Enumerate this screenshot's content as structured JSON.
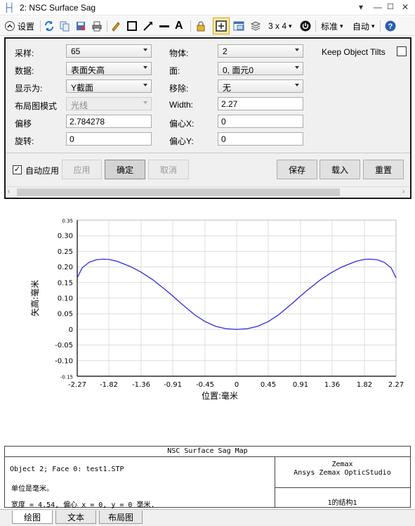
{
  "window": {
    "title": "2: NSC Surface Sag",
    "app_icon_text": "├┤"
  },
  "toolbar": {
    "settings_label": "设置",
    "layout_label": "3 x 4",
    "standard_label": "标准",
    "auto_label": "自动"
  },
  "settings": {
    "sampling_label": "采样:",
    "sampling_value": "65",
    "data_label": "数据:",
    "data_value": "表面矢高",
    "display_label": "显示为:",
    "display_value": "Y截面",
    "layout_mode_label": "布局图模式",
    "layout_mode_value": "光线",
    "offset_label": "偏移",
    "offset_value": "2.784278",
    "rotation_label": "旋转:",
    "rotation_value": "0",
    "object_label": "物体:",
    "object_value": "2",
    "face_label": "面:",
    "face_value": "0, 面元0",
    "remove_label": "移除:",
    "remove_value": "无",
    "width_label": "Width:",
    "width_value": "2.27",
    "decenter_x_label": "偏心X:",
    "decenter_x_value": "0",
    "decenter_y_label": "偏心Y:",
    "decenter_y_value": "0",
    "keep_tilts_label": "Keep Object Tilts",
    "auto_apply_label": "自动应用",
    "apply_label": "应用",
    "ok_label": "确定",
    "cancel_label": "取消",
    "save_label": "保存",
    "load_label": "载入",
    "reset_label": "重置"
  },
  "chart_data": {
    "type": "line",
    "xlabel": "位置:毫米",
    "ylabel": "矢高:毫米",
    "xlim": [
      -2.27,
      2.27
    ],
    "ylim": [
      -0.15,
      0.35
    ],
    "xticks": [
      -2.27,
      -1.82,
      -1.36,
      -0.91,
      -0.45,
      0,
      0.45,
      0.91,
      1.36,
      1.82,
      2.27
    ],
    "yticks": [
      -0.15,
      -0.1,
      -0.05,
      0,
      0.05,
      0.1,
      0.15,
      0.2,
      0.25,
      0.3,
      0.35
    ],
    "xtick_labels": [
      "-2.27",
      "-1.82",
      "-1.36",
      "-0.91",
      "-0.45",
      "0",
      "0.45",
      "0.91",
      "1.36",
      "1.82",
      "2.27"
    ],
    "ytick_labels": [
      "-0.15",
      "-0.10",
      "-0.05",
      "0",
      "0.05",
      "0.10",
      "0.15",
      "0.20",
      "0.25",
      "0.30",
      "0.35"
    ],
    "series": [
      {
        "color": "#2b2bdc",
        "x": [
          -2.27,
          -2.2,
          -2.1,
          -2.0,
          -1.9,
          -1.82,
          -1.7,
          -1.5,
          -1.36,
          -1.2,
          -1.0,
          -0.91,
          -0.8,
          -0.6,
          -0.45,
          -0.3,
          -0.15,
          0,
          0.15,
          0.3,
          0.45,
          0.6,
          0.8,
          0.91,
          1.0,
          1.2,
          1.36,
          1.5,
          1.7,
          1.82,
          1.9,
          2.0,
          2.1,
          2.2,
          2.27
        ],
        "y": [
          0.165,
          0.197,
          0.215,
          0.223,
          0.225,
          0.224,
          0.218,
          0.2,
          0.183,
          0.16,
          0.124,
          0.107,
          0.085,
          0.047,
          0.025,
          0.01,
          0.002,
          0.0,
          0.002,
          0.01,
          0.025,
          0.047,
          0.085,
          0.107,
          0.124,
          0.16,
          0.183,
          0.2,
          0.218,
          0.224,
          0.225,
          0.223,
          0.215,
          0.197,
          0.165
        ]
      }
    ]
  },
  "info": {
    "title": "NSC Surface Sag Map",
    "object_line": "Object 2; Face 0: test1.STP",
    "units_line": "单位是毫米。",
    "width_line": "宽度 = 4.54, 偏心 x = 0, y = 0 毫米.",
    "company": "Zemax",
    "product": "Ansys Zemax OpticStudio",
    "config": "1的结构1"
  },
  "tabs": [
    "绘图",
    "文本",
    "布局图"
  ]
}
